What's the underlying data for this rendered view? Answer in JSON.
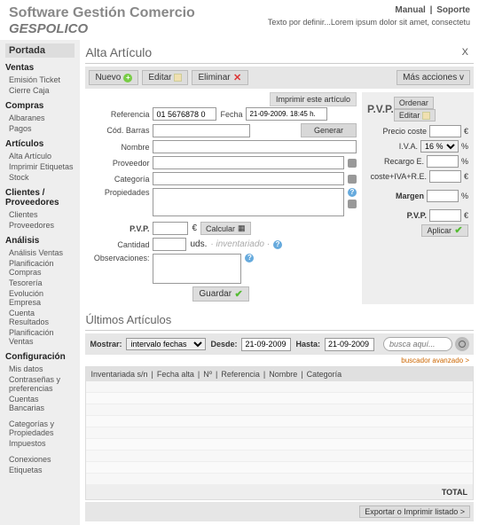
{
  "header": {
    "title1": "Software Gestión Comercio",
    "title2": "GESPOLICO",
    "manual": "Manual",
    "soporte": "Soporte",
    "tagline": "Texto por definir...Lorem ipsum dolor sit amet, consectetu"
  },
  "sidebar": {
    "portada": "Portada",
    "groups": [
      {
        "title": "Ventas",
        "items": [
          "Emisión Ticket",
          "Cierre Caja"
        ]
      },
      {
        "title": "Compras",
        "items": [
          "Albaranes",
          "Pagos"
        ]
      },
      {
        "title": "Artículos",
        "items": [
          "Alta Artículo",
          "Imprimir Etiquetas",
          "Stock"
        ]
      },
      {
        "title": "Clientes / Proveedores",
        "items": [
          "Clientes",
          "Proveedores"
        ]
      },
      {
        "title": "Análisis",
        "items": [
          "Análisis Ventas",
          "Planificación Compras",
          "Tesorería",
          "Evolución Empresa",
          "Cuenta Resultados",
          "Planificación Ventas"
        ]
      },
      {
        "title": "Configuración",
        "items": [
          "Mis datos",
          "Contraseñas y preferencias",
          "Cuentas Bancarias"
        ]
      },
      {
        "title": "",
        "items": [
          "Categorías y Propiedades",
          "Impuestos"
        ]
      },
      {
        "title": "",
        "items": [
          "Conexiones",
          "Etiquetas"
        ]
      }
    ]
  },
  "page": {
    "title": "Alta Artículo",
    "close": "X"
  },
  "toolbar": {
    "nuevo": "Nuevo",
    "editar": "Editar",
    "eliminar": "Eliminar",
    "mas": "Más acciones v",
    "imprimir": "Imprimir este artículo"
  },
  "form": {
    "ref_label": "Referencia",
    "ref_value": "01 5676878 0",
    "fecha_label": "Fecha",
    "fecha_value": "21-09-2009. 18:45 h.",
    "codbarras_label": "Cód. Barras",
    "generar": "Generar",
    "nombre_label": "Nombre",
    "proveedor_label": "Proveedor",
    "categoria_label": "Categoría",
    "propiedades_label": "Propiedades",
    "pvp_label": "P.V.P.",
    "eur": "€",
    "calcular": "Calcular",
    "cantidad_label": "Cantidad",
    "uds": "uds.",
    "inventariado": "· inventariado ·",
    "obs_label": "Observaciones:",
    "guardar": "Guardar"
  },
  "pvp": {
    "title": "P.V.P.",
    "ordenar": "Ordenar",
    "editar": "Editar",
    "precio_coste": "Precio coste",
    "eur": "€",
    "iva": "I.V.A.",
    "iva_val": "16 %",
    "pct": "%",
    "recargo": "Recargo E.",
    "coste_total": "coste+IVA+R.E.",
    "margen": "Margen",
    "pvp_final": "P.V.P.",
    "aplicar": "Aplicar"
  },
  "ultimos": {
    "title": "Últimos Artículos",
    "mostrar": "Mostrar:",
    "intervalo": "intervalo fechas",
    "desde": "Desde:",
    "desde_val": "21-09-2009",
    "hasta": "Hasta:",
    "hasta_val": "21-09-2009",
    "search_ph": "busca aquí...",
    "adv": "buscador avanzado >",
    "cols": [
      "Inventariada s/n",
      "Fecha alta",
      "Nº",
      "Referencia",
      "Nombre",
      "Categoría"
    ],
    "total": "TOTAL",
    "exportar": "Exportar o Imprimir listado >"
  }
}
